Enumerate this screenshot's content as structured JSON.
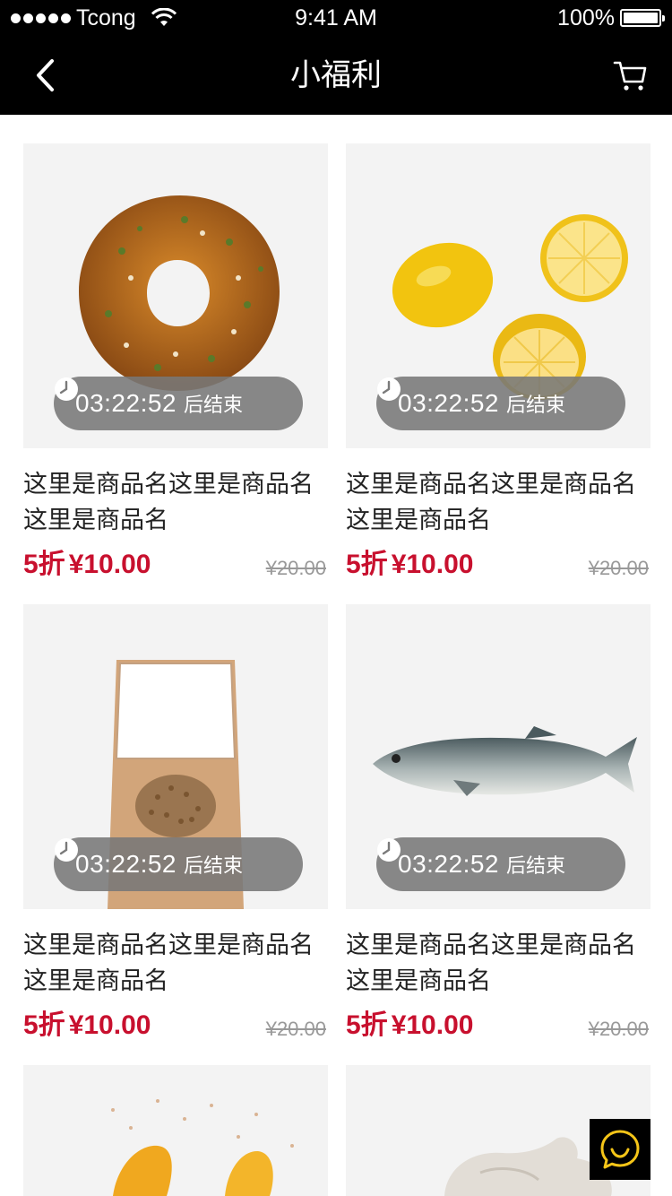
{
  "status": {
    "carrier": "Tcong",
    "time": "9:41 AM",
    "battery": "100%",
    "battery_level": 1.0
  },
  "nav": {
    "title": "小福利",
    "back_icon": "chevron-left-icon",
    "cart_icon": "cart-icon"
  },
  "products": [
    {
      "image": "donut",
      "timer": "03:22:52",
      "timer_suffix": "后结束",
      "name": "这里是商品名这里是商品名这里是商品名",
      "discount": "5折",
      "price": "¥10.00",
      "original_price": "¥20.00"
    },
    {
      "image": "lemons",
      "timer": "03:22:52",
      "timer_suffix": "后结束",
      "name": "这里是商品名这里是商品名这里是商品名",
      "discount": "5折",
      "price": "¥10.00",
      "original_price": "¥20.00"
    },
    {
      "image": "grain-bag",
      "timer": "03:22:52",
      "timer_suffix": "后结束",
      "name": "这里是商品名这里是商品名这里是商品名",
      "discount": "5折",
      "price": "¥10.00",
      "original_price": "¥20.00"
    },
    {
      "image": "fish",
      "timer": "03:22:52",
      "timer_suffix": "后结束",
      "name": "这里是商品名这里是商品名这里是商品名",
      "discount": "5折",
      "price": "¥10.00",
      "original_price": "¥20.00"
    }
  ],
  "partial_products": [
    {
      "image": "mangoes"
    },
    {
      "image": "poultry"
    }
  ],
  "colors": {
    "accent_red": "#c8102e",
    "chat_icon_yellow": "#f5c518"
  },
  "chat_icon": "chat-smile-icon"
}
